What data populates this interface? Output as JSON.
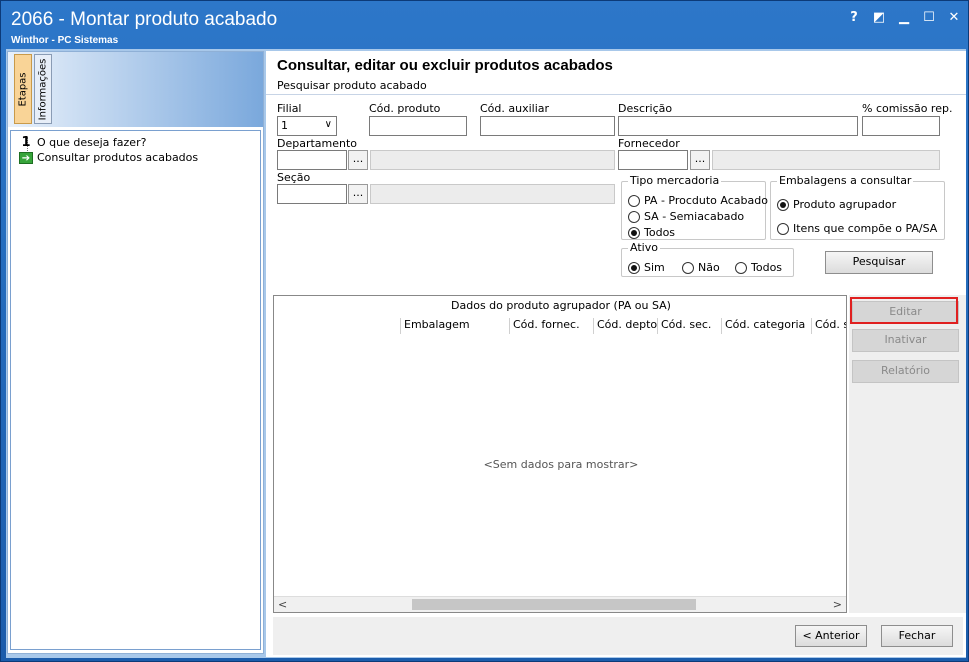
{
  "window": {
    "title": "2066 - Montar produto acabado",
    "subtitle": "Winthor - PC Sistemas",
    "help": "?",
    "restore": "◩",
    "minimize": "▁",
    "maximize": "☐",
    "close": "✕"
  },
  "left_tabs": {
    "etapas": "Etapas",
    "informacoes": "Informações"
  },
  "steps": [
    {
      "num": "1",
      "label": "O que deseja fazer?"
    },
    {
      "label": "Consultar produtos acabados"
    }
  ],
  "header": {
    "title": "Consultar, editar ou excluir produtos acabados",
    "subtitle": "Pesquisar produto acabado"
  },
  "form": {
    "filial_label": "Filial",
    "filial_value": "1",
    "cod_produto_label": "Cód. produto",
    "cod_auxiliar_label": "Cód. auxiliar",
    "descricao_label": "Descrição",
    "comissao_label": "% comissão rep.",
    "departamento_label": "Departamento",
    "fornecedor_label": "Fornecedor",
    "secao_label": "Seção",
    "ellipsis": "..."
  },
  "tipo_mercadoria": {
    "title": "Tipo mercadoria",
    "options": [
      {
        "label": "PA - Procduto Acabado",
        "selected": false
      },
      {
        "label": "SA - Semiacabado",
        "selected": false
      },
      {
        "label": "Todos",
        "selected": true
      }
    ]
  },
  "embalagens": {
    "title": "Embalagens a consultar",
    "options": [
      {
        "label": "Produto agrupador",
        "selected": true
      },
      {
        "label": "Itens que compõe o PA/SA",
        "selected": false
      }
    ]
  },
  "ativo": {
    "title": "Ativo",
    "options": [
      {
        "label": "Sim",
        "selected": true
      },
      {
        "label": "Não",
        "selected": false
      },
      {
        "label": "Todos",
        "selected": false
      }
    ]
  },
  "buttons": {
    "pesquisar": "Pesquisar",
    "editar": "Editar",
    "inativar": "Inativar",
    "relatorio": "Relatório",
    "anterior": "< Anterior",
    "fechar": "Fechar"
  },
  "grid": {
    "caption": "Dados do produto agrupador (PA ou SA)",
    "columns": [
      "Embalagem",
      "Cód. fornec.",
      "Cód. depto.",
      "Cód. sec.",
      "Cód. categoria",
      "Cód. su"
    ],
    "empty_text": "<Sem dados para mostrar>"
  },
  "colors": {
    "frame": "#1b5cab",
    "highlight": "#e02020"
  }
}
